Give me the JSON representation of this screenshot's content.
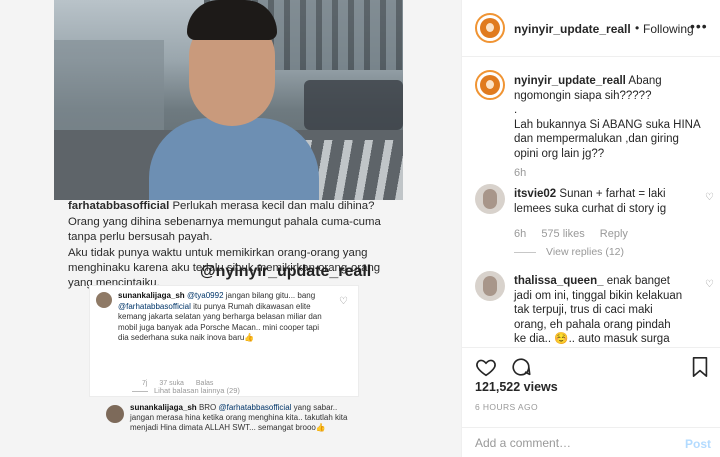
{
  "image": {
    "caption_user": "farhatabbasofficial",
    "caption_lines": [
      "Perlukah merasa kecil dan malu dihina?",
      "Orang yang dihina sebenarnya memungut pahala cuma-cuma tanpa perlu bersusah payah.",
      "Aku tidak punya waktu untuk memikirkan orang-orang yang menghinaku karena aku terlalu sibuk memikirkan orang-orang yang mencintaiku."
    ],
    "watermark": "@nyinyir_update_reall",
    "embed_comment": {
      "user": "sunankalijaga_sh",
      "mention": "@tya0992",
      "text1": "jangan bilang gitu... bang",
      "mention2": "@farhatabbasofficial",
      "text2": "itu punya Rumah dikawasan elite kemang jakarta selatan yang berharga belasan miliar dan mobil juga banyak ada Porsche Macan.. mini cooper tapi dia sederhana suka naik inova baru👍",
      "time": "7j",
      "likes": "37 suka",
      "reply": "Balas"
    },
    "more_replies": "Lihat balasan lainnya (29)",
    "reply2": {
      "user": "sunankalijaga_sh",
      "text1": "BRO",
      "mention": "@farhatabbasofficial",
      "text2": "yang sabar.. jangan merasa hina ketika orang menghina kita.. takutlah kita menjadi Hina dimata ALLAH SWT... semangat brooo👍"
    }
  },
  "header": {
    "username": "nyinyir_update_reall",
    "dot": "•",
    "follow_status": "Following",
    "more": "•••"
  },
  "caption": {
    "username": "nyinyir_update_reall",
    "text_lines": [
      "Abang ngomongin siapa sih?????",
      ".",
      "Lah bukannya Si ABANG suka HINA dan mempermalukan ,dan giring opini org lain jg??"
    ],
    "time": "6h"
  },
  "comments": [
    {
      "username": "itsvie02",
      "text": "Sunan + farhat = laki lemees suka curhat di story ig",
      "time": "6h",
      "likes": "575 likes",
      "reply": "Reply",
      "view_replies": "View replies (12)"
    },
    {
      "username": "thalissa_queen_",
      "text": "enak banget jadi om ini, tinggal bikin kelakuan tak terpuji, trus di caci maki orang, eh pahala orang pindah ke dia.. ☺️.. auto masuk surga nih om, bareng"
    }
  ],
  "actions": {
    "views": "121,522 views",
    "time_ago": "6 HOURS AGO"
  },
  "add_comment": {
    "placeholder": "Add a comment…",
    "post_label": "Post"
  },
  "colors": {
    "link": "#003569",
    "muted": "#999999",
    "post_disabled": "#b3dbff",
    "story_ring": "#f09433"
  }
}
